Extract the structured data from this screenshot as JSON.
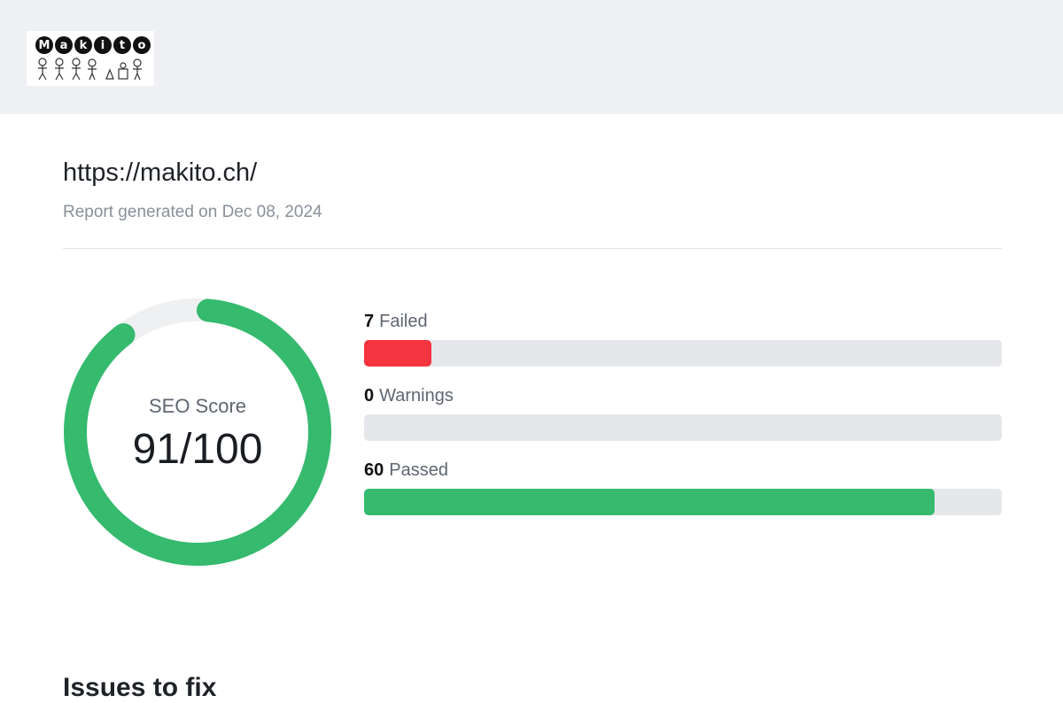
{
  "header": {
    "logo": {
      "word_letters": [
        "M",
        "a",
        "k",
        "i",
        "t",
        "o"
      ],
      "icon": "makito-logo-icon"
    }
  },
  "report": {
    "url": "https://makito.ch/",
    "generated": "Report generated on Dec 08, 2024"
  },
  "score": {
    "label": "SEO Score",
    "display": "91/100",
    "value": 91,
    "max": 100,
    "color": "#35ba6e",
    "track_color": "#eff0f2"
  },
  "stats": [
    {
      "count": "7",
      "label": "Failed",
      "fill_fraction": 0.105,
      "color": "#f4343f"
    },
    {
      "count": "0",
      "label": "Warnings",
      "fill_fraction": 0.0,
      "color": "#f5a623"
    },
    {
      "count": "60",
      "label": "Passed",
      "fill_fraction": 0.895,
      "color": "#35ba6e"
    }
  ],
  "sections": {
    "issues_title": "Issues to fix"
  }
}
